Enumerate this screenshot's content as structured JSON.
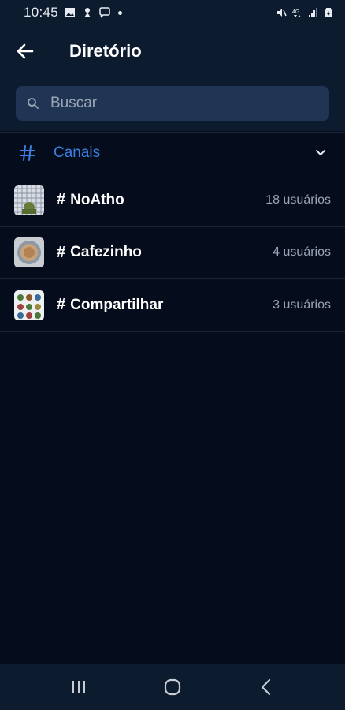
{
  "status_bar": {
    "time": "10:45",
    "left_icons": [
      "image-icon",
      "notification-icon",
      "chat-icon"
    ],
    "right_icons": [
      "mute-icon",
      "4g-icon",
      "signal-icon",
      "battery-icon"
    ]
  },
  "app_bar": {
    "title": "Diretório",
    "back_icon": "arrow-left-icon"
  },
  "search": {
    "placeholder": "Buscar",
    "value": ""
  },
  "section": {
    "label": "Canais",
    "icon": "hash-icon",
    "expanded": true
  },
  "channels": [
    {
      "name": "NoAtho",
      "hash": "#",
      "count": "18 usuários"
    },
    {
      "name": "Cafezinho",
      "hash": "#",
      "count": "4 usuários"
    },
    {
      "name": "Compartilhar",
      "hash": "#",
      "count": "3 usuários"
    }
  ],
  "nav_bar": {
    "buttons": [
      "recent-apps-icon",
      "home-icon",
      "back-icon"
    ]
  },
  "colors": {
    "background": "#050c1c",
    "surface": "#0d1b2e",
    "search_bg": "#1f3553",
    "accent": "#3d7fe0",
    "secondary_text": "#9aa6b6"
  }
}
